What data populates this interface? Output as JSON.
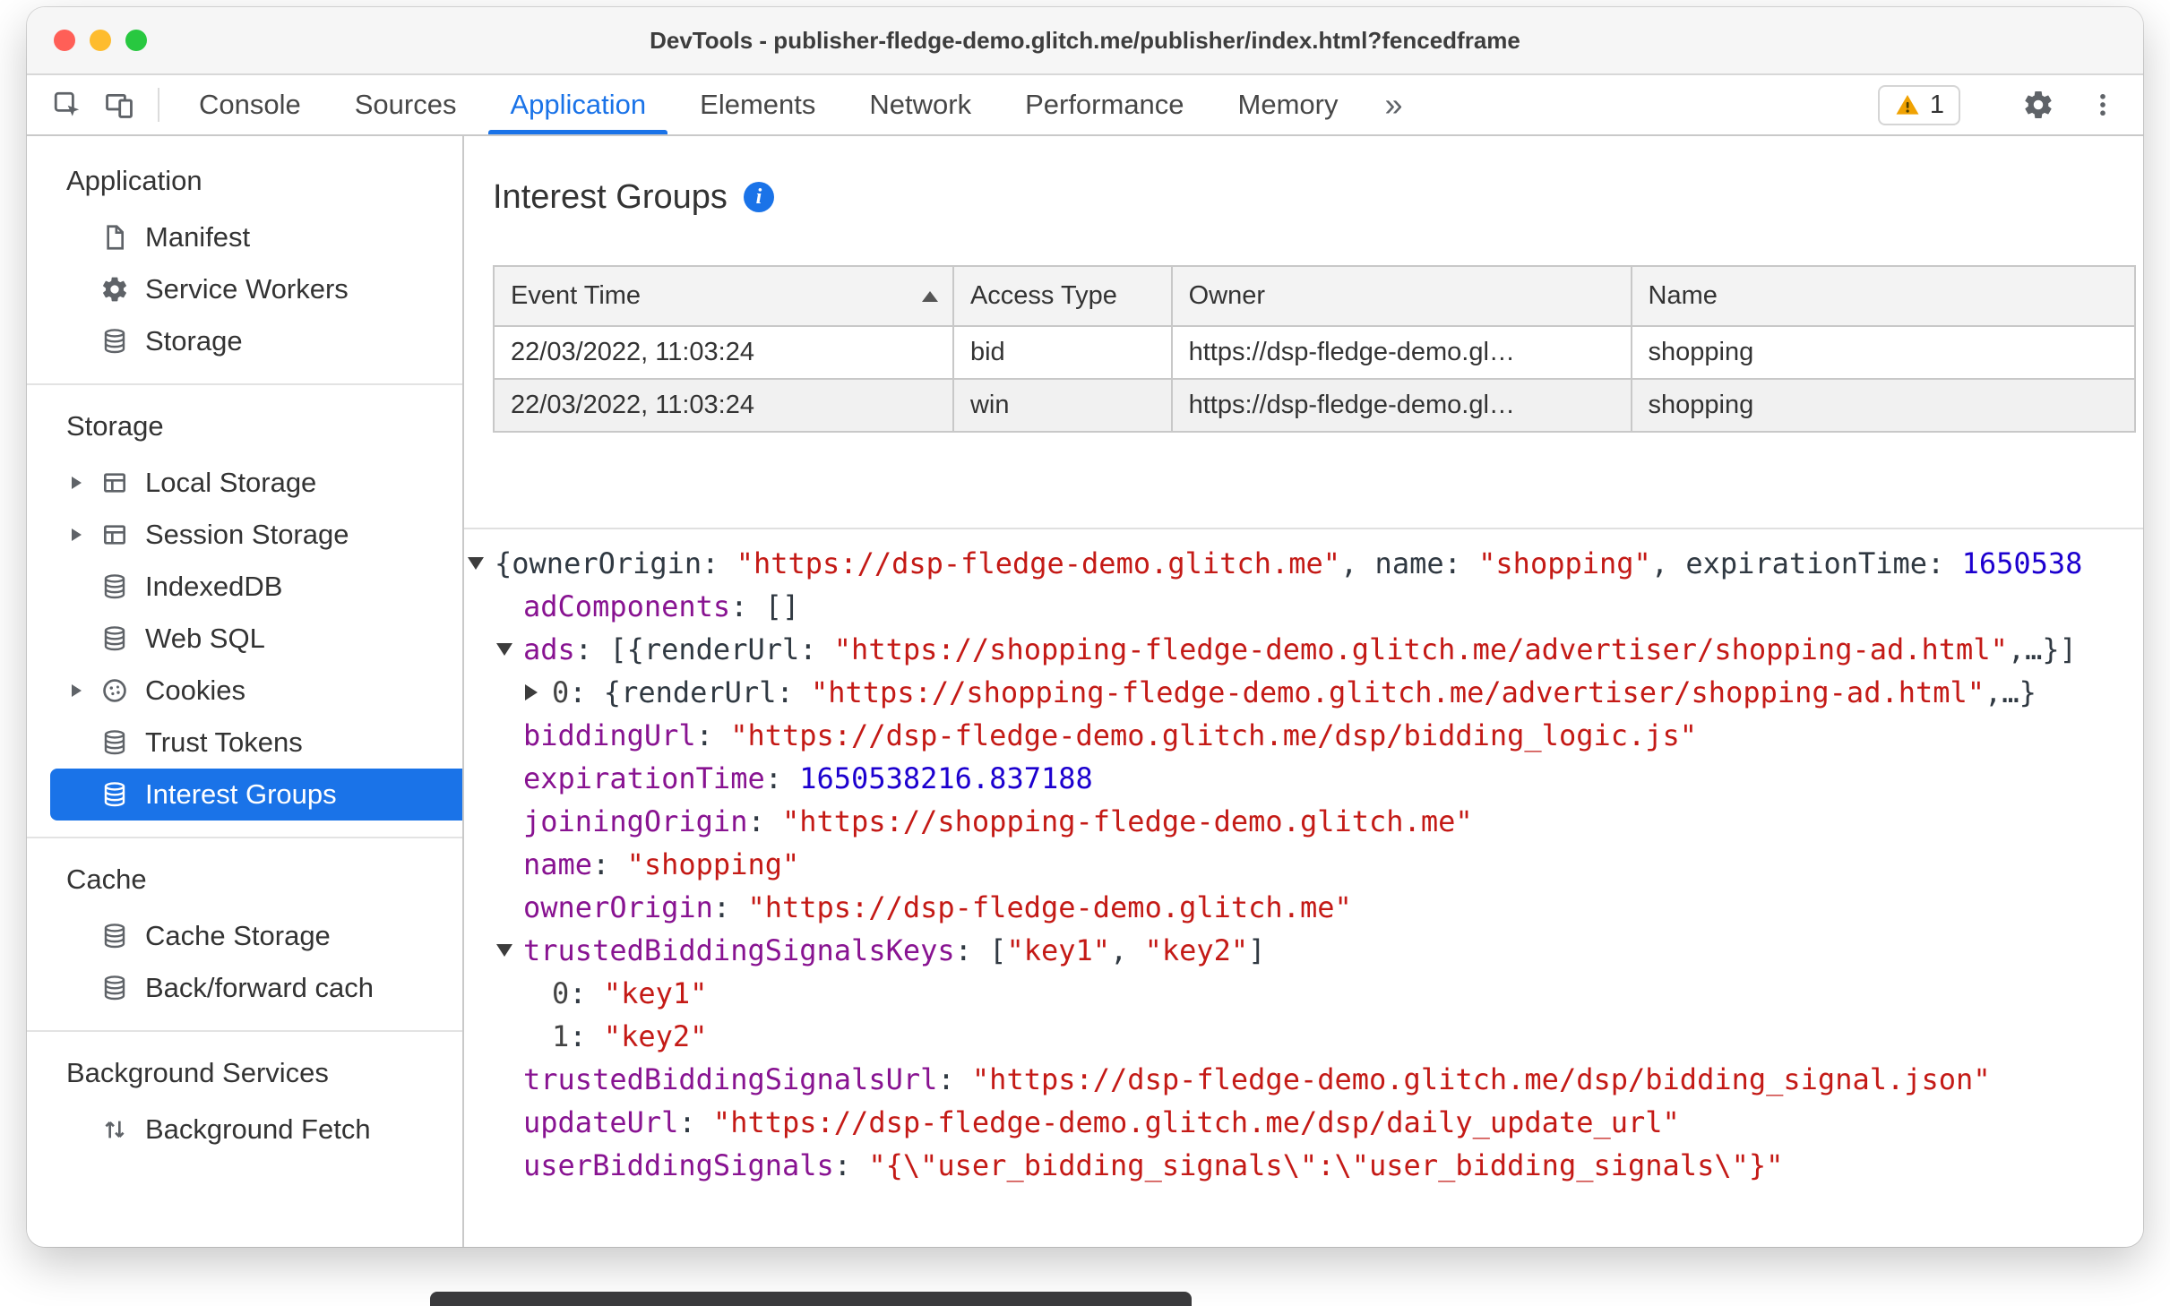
{
  "colors": {
    "accent_blue": "#1a73e8",
    "tree_key_purple": "#881391",
    "tree_string_red": "#c41a16",
    "tree_number_blue": "#1c00cf",
    "warning_yellow": "#f0a202",
    "selected_item_bg": "#1a73e8"
  },
  "window": {
    "title": "DevTools - publisher-fledge-demo.glitch.me/publisher/index.html?fencedframe",
    "traffic_lights": [
      "close",
      "minimize",
      "zoom"
    ]
  },
  "toolbar": {
    "inspect_icon": "inspect-cursor-icon",
    "device_icon": "device-toolbar-icon",
    "tabs": [
      "Console",
      "Sources",
      "Application",
      "Elements",
      "Network",
      "Performance",
      "Memory"
    ],
    "active_tab": "Application",
    "more_tabs_label": "»",
    "warning_badge": {
      "icon": "warning-triangle-icon",
      "count": "1"
    },
    "settings_icon": "gear-icon",
    "menu_icon": "kebab-menu-icon"
  },
  "sidebar": {
    "sections": [
      {
        "header": "Application",
        "items": [
          {
            "label": "Manifest",
            "icon": "file-icon"
          },
          {
            "label": "Service Workers",
            "icon": "gear-icon"
          },
          {
            "label": "Storage",
            "icon": "database-icon"
          }
        ]
      },
      {
        "header": "Storage",
        "items": [
          {
            "label": "Local Storage",
            "icon": "table-icon",
            "expandable": true
          },
          {
            "label": "Session Storage",
            "icon": "table-icon",
            "expandable": true
          },
          {
            "label": "IndexedDB",
            "icon": "database-icon"
          },
          {
            "label": "Web SQL",
            "icon": "database-icon"
          },
          {
            "label": "Cookies",
            "icon": "cookie-icon",
            "expandable": true
          },
          {
            "label": "Trust Tokens",
            "icon": "database-icon"
          },
          {
            "label": "Interest Groups",
            "icon": "database-icon",
            "selected": true
          }
        ]
      },
      {
        "header": "Cache",
        "items": [
          {
            "label": "Cache Storage",
            "icon": "database-icon"
          },
          {
            "label": "Back/forward cach",
            "icon": "database-icon"
          }
        ]
      },
      {
        "header": "Background Services",
        "items": [
          {
            "label": "Background Fetch",
            "icon": "up-down-icon"
          }
        ]
      }
    ]
  },
  "main": {
    "title": "Interest Groups",
    "info_glyph": "i",
    "table": {
      "columns": [
        "Event Time",
        "Access Type",
        "Owner",
        "Name"
      ],
      "sort": {
        "column": "Event Time",
        "direction": "ascending"
      },
      "rows": [
        [
          "22/03/2022, 11:03:24",
          "bid",
          "https://dsp-fledge-demo.gl…",
          "shopping"
        ],
        [
          "22/03/2022, 11:03:24",
          "win",
          "https://dsp-fledge-demo.gl…",
          "shopping"
        ]
      ]
    },
    "tree": {
      "lines": [
        {
          "indent": 0,
          "arrow": "down",
          "segments": [
            {
              "c": "p",
              "t": "{ownerOrigin: "
            },
            {
              "c": "s",
              "t": "\"https://dsp-fledge-demo.glitch.me\""
            },
            {
              "c": "p",
              "t": ", name: "
            },
            {
              "c": "s",
              "t": "\"shopping\""
            },
            {
              "c": "p",
              "t": ", expirationTime: "
            },
            {
              "c": "n",
              "t": "1650538"
            }
          ]
        },
        {
          "indent": 1,
          "arrow": null,
          "segments": [
            {
              "c": "k",
              "t": "adComponents"
            },
            {
              "c": "p",
              "t": ": []"
            }
          ]
        },
        {
          "indent": 1,
          "arrow": "down",
          "segments": [
            {
              "c": "k",
              "t": "ads"
            },
            {
              "c": "p",
              "t": ": [{renderUrl: "
            },
            {
              "c": "s",
              "t": "\"https://shopping-fledge-demo.glitch.me/advertiser/shopping-ad.html\""
            },
            {
              "c": "p",
              "t": ",…}]"
            }
          ]
        },
        {
          "indent": 2,
          "arrow": "right",
          "segments": [
            {
              "c": "i",
              "t": "0"
            },
            {
              "c": "p",
              "t": ": {renderUrl: "
            },
            {
              "c": "s",
              "t": "\"https://shopping-fledge-demo.glitch.me/advertiser/shopping-ad.html\""
            },
            {
              "c": "p",
              "t": ",…}"
            }
          ]
        },
        {
          "indent": 1,
          "arrow": null,
          "segments": [
            {
              "c": "k",
              "t": "biddingUrl"
            },
            {
              "c": "p",
              "t": ": "
            },
            {
              "c": "s",
              "t": "\"https://dsp-fledge-demo.glitch.me/dsp/bidding_logic.js\""
            }
          ]
        },
        {
          "indent": 1,
          "arrow": null,
          "segments": [
            {
              "c": "k",
              "t": "expirationTime"
            },
            {
              "c": "p",
              "t": ": "
            },
            {
              "c": "n",
              "t": "1650538216.837188"
            }
          ]
        },
        {
          "indent": 1,
          "arrow": null,
          "segments": [
            {
              "c": "k",
              "t": "joiningOrigin"
            },
            {
              "c": "p",
              "t": ": "
            },
            {
              "c": "s",
              "t": "\"https://shopping-fledge-demo.glitch.me\""
            }
          ]
        },
        {
          "indent": 1,
          "arrow": null,
          "segments": [
            {
              "c": "k",
              "t": "name"
            },
            {
              "c": "p",
              "t": ": "
            },
            {
              "c": "s",
              "t": "\"shopping\""
            }
          ]
        },
        {
          "indent": 1,
          "arrow": null,
          "segments": [
            {
              "c": "k",
              "t": "ownerOrigin"
            },
            {
              "c": "p",
              "t": ": "
            },
            {
              "c": "s",
              "t": "\"https://dsp-fledge-demo.glitch.me\""
            }
          ]
        },
        {
          "indent": 1,
          "arrow": "down",
          "segments": [
            {
              "c": "k",
              "t": "trustedBiddingSignalsKeys"
            },
            {
              "c": "p",
              "t": ": ["
            },
            {
              "c": "s",
              "t": "\"key1\""
            },
            {
              "c": "p",
              "t": ", "
            },
            {
              "c": "s",
              "t": "\"key2\""
            },
            {
              "c": "p",
              "t": "]"
            }
          ]
        },
        {
          "indent": 2,
          "arrow": null,
          "segments": [
            {
              "c": "i",
              "t": "0"
            },
            {
              "c": "p",
              "t": ": "
            },
            {
              "c": "s",
              "t": "\"key1\""
            }
          ]
        },
        {
          "indent": 2,
          "arrow": null,
          "segments": [
            {
              "c": "i",
              "t": "1"
            },
            {
              "c": "p",
              "t": ": "
            },
            {
              "c": "s",
              "t": "\"key2\""
            }
          ]
        },
        {
          "indent": 1,
          "arrow": null,
          "segments": [
            {
              "c": "k",
              "t": "trustedBiddingSignalsUrl"
            },
            {
              "c": "p",
              "t": ": "
            },
            {
              "c": "s",
              "t": "\"https://dsp-fledge-demo.glitch.me/dsp/bidding_signal.json\""
            }
          ]
        },
        {
          "indent": 1,
          "arrow": null,
          "segments": [
            {
              "c": "k",
              "t": "updateUrl"
            },
            {
              "c": "p",
              "t": ": "
            },
            {
              "c": "s",
              "t": "\"https://dsp-fledge-demo.glitch.me/dsp/daily_update_url\""
            }
          ]
        },
        {
          "indent": 1,
          "arrow": null,
          "segments": [
            {
              "c": "k",
              "t": "userBiddingSignals"
            },
            {
              "c": "p",
              "t": ": "
            },
            {
              "c": "s",
              "t": "\"{\\\"user_bidding_signals\\\":\\\"user_bidding_signals\\\"}\""
            }
          ]
        }
      ]
    }
  }
}
